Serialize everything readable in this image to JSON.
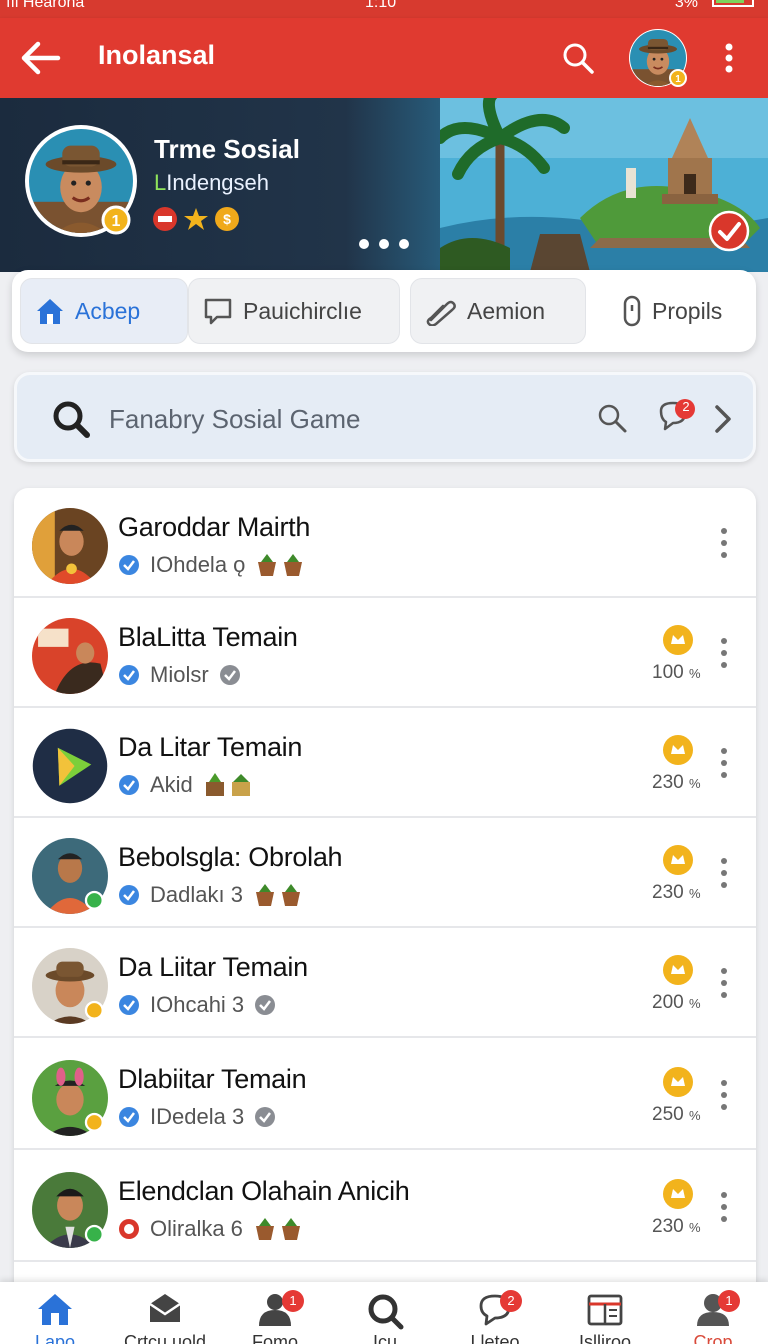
{
  "status_bar": {
    "left": "ııl Hearona",
    "center": "1:10",
    "right": "3%"
  },
  "app_bar": {
    "title": "Inolansal"
  },
  "profile": {
    "name": "Trme Sosial",
    "subtitle_first": "L",
    "subtitle_rest": "Indengseh"
  },
  "tabs": [
    {
      "label": "Acbep",
      "icon": "home-icon",
      "active": true
    },
    {
      "label": "Pauichirclıe",
      "icon": "chat-icon"
    },
    {
      "label": "Aemion",
      "icon": "link-icon"
    },
    {
      "label": "Propils",
      "icon": "phone-icon"
    }
  ],
  "search": {
    "placeholder": "Fanabry Sosial Game",
    "chat_badge": "2"
  },
  "list": [
    {
      "title": "Garoddar Mairth",
      "meta": "IOhdela ǫ",
      "verify": "blue",
      "extra": "pots",
      "coin": false,
      "pct": "",
      "avatar": "man-red-shirt"
    },
    {
      "title": "BlaLitta Temain",
      "meta": "Miolsr",
      "verify": "blue",
      "extra": "check",
      "coin": true,
      "pct": "100",
      "avatar": "red-poster"
    },
    {
      "title": "Da Litar Temain",
      "meta": "Akid",
      "verify": "blue",
      "extra": "plants",
      "coin": true,
      "pct": "230",
      "avatar": "play-logo"
    },
    {
      "title": "Bebolsgla: Obrolah",
      "meta": "Dadlakı 3",
      "verify": "blue",
      "extra": "pots",
      "coin": true,
      "pct": "230",
      "avatar": "man-orange-shirt"
    },
    {
      "title": "Da Liitar Temain",
      "meta": "IOhcahi 3",
      "verify": "blue",
      "extra": "check",
      "coin": true,
      "pct": "200",
      "avatar": "man-hat"
    },
    {
      "title": "Dlabiitar Temain",
      "meta": "IDedela 3",
      "verify": "blue",
      "extra": "check",
      "coin": true,
      "pct": "250",
      "avatar": "man-bunny-ears"
    },
    {
      "title": "Elendclan Olahain Anicih",
      "meta": "Oliralka 6",
      "verify": "red",
      "extra": "pots",
      "coin": true,
      "pct": "230",
      "avatar": "man-jacket"
    }
  ],
  "pct_unit": "%",
  "bottom_nav": [
    {
      "label": "Lapo",
      "icon": "home-icon",
      "badge": ""
    },
    {
      "label": "Crtcu uold",
      "icon": "mail-icon",
      "badge": ""
    },
    {
      "label": "Fomo",
      "icon": "person-icon",
      "badge": "1"
    },
    {
      "label": "Icu",
      "icon": "search-icon",
      "badge": ""
    },
    {
      "label": "Lleteo",
      "icon": "chat-bubble-icon",
      "badge": "2"
    },
    {
      "label": "Islliroo",
      "icon": "store-icon",
      "badge": ""
    },
    {
      "label": "Crop",
      "icon": "profile-icon",
      "badge": "1"
    }
  ],
  "colors": {
    "primary": "#e03a30",
    "accent": "#2a72d8",
    "coin": "#f2b31c"
  }
}
